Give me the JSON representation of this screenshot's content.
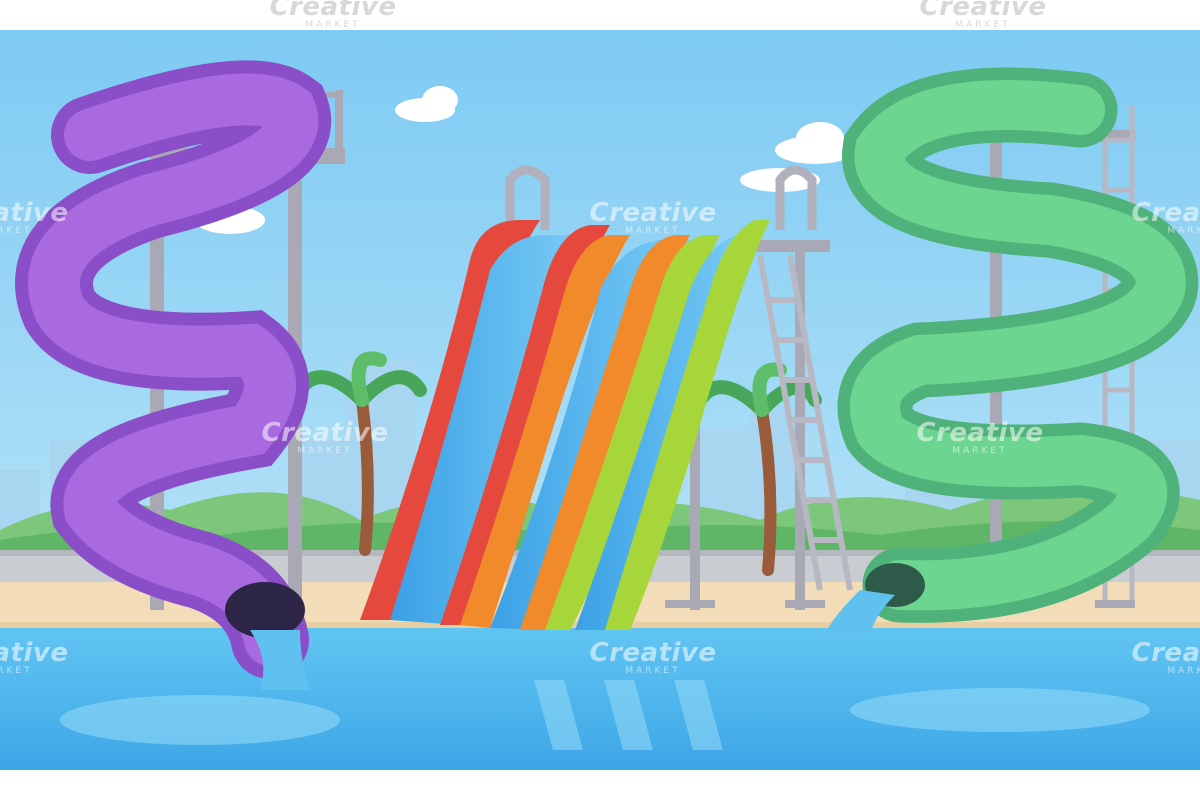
{
  "watermark": {
    "brand": "Creative",
    "sub": "MARKET"
  },
  "colors": {
    "sky": "#8fd3f6",
    "purple_slide": "#9b5fd6",
    "green_slide": "#62cf8e",
    "pool": "#5ec1f0",
    "sand": "#f3dcb8",
    "tower": "#a9a9b5"
  }
}
